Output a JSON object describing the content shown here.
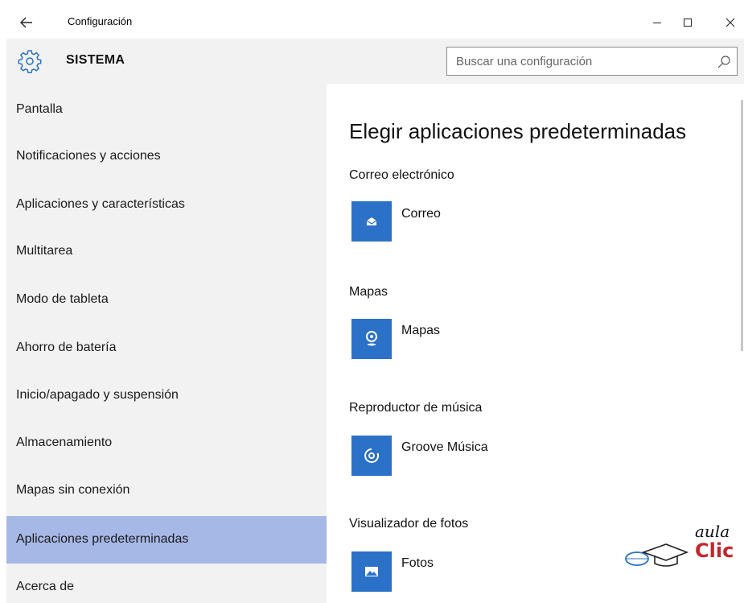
{
  "window": {
    "title": "Configuración",
    "controls": {
      "minimize": "minimize",
      "maximize": "maximize",
      "close": "close"
    }
  },
  "header": {
    "icon": "gear-icon",
    "title": "SISTEMA",
    "search_placeholder": "Buscar una configuración",
    "search_icon": "search-icon"
  },
  "sidebar": {
    "active_index": 9,
    "active_color": "#a6b8e6",
    "items": [
      {
        "label": "Pantalla"
      },
      {
        "label": "Notificaciones y acciones"
      },
      {
        "label": "Aplicaciones y características"
      },
      {
        "label": "Multitarea"
      },
      {
        "label": "Modo de tableta"
      },
      {
        "label": "Ahorro de batería"
      },
      {
        "label": "Inicio/apagado y suspensión"
      },
      {
        "label": "Almacenamiento"
      },
      {
        "label": "Mapas sin conexión"
      },
      {
        "label": "Aplicaciones predeterminadas"
      },
      {
        "label": "Acerca de"
      }
    ]
  },
  "main": {
    "title": "Elegir aplicaciones predeterminadas",
    "tile_color": "#2b71c7",
    "categories": [
      {
        "label": "Correo electrónico",
        "app": "Correo",
        "icon": "mail-icon"
      },
      {
        "label": "Mapas",
        "app": "Mapas",
        "icon": "map-pin-icon"
      },
      {
        "label": "Reproductor de música",
        "app": "Groove Música",
        "icon": "music-disc-icon"
      },
      {
        "label": "Visualizador de fotos",
        "app": "Fotos",
        "icon": "photo-icon"
      }
    ]
  },
  "watermark": {
    "line1": "aula",
    "line2": "Clic",
    "accent": "#c4252c"
  }
}
